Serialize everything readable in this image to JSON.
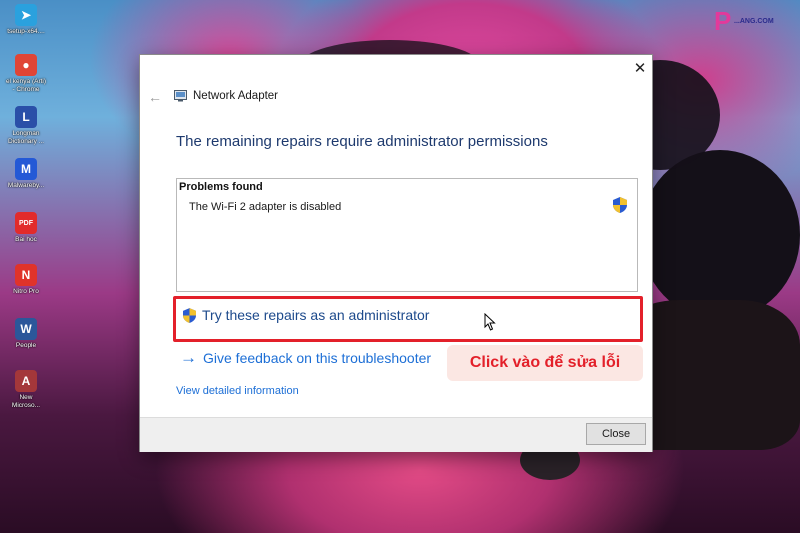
{
  "desktop": {
    "icons": [
      {
        "name": "telegram-icon",
        "label": "tsetup-x64....",
        "color": "#2aa1de",
        "glyph": "➤"
      },
      {
        "name": "chrome-icon",
        "label": "el kenya (Arti)\n- Chrome",
        "color": "#e04536",
        "glyph": "●"
      },
      {
        "name": "longman-dictionary-icon",
        "label": "Longman\nDictionary ...",
        "color": "#2a4fa8",
        "glyph": "L"
      },
      {
        "name": "malwarebytes-icon",
        "label": "Malwareby...",
        "color": "#2459d6",
        "glyph": "M"
      },
      {
        "name": "pdf-file-icon",
        "label": "Bai hoc",
        "color": "#e22b2b",
        "glyph": "PDF"
      },
      {
        "name": "nitro-pro-icon",
        "label": "Nitro Pro",
        "color": "#e0332a",
        "glyph": "N"
      },
      {
        "name": "word-doc-icon",
        "label": "People",
        "color": "#2b579a",
        "glyph": "W"
      },
      {
        "name": "access-file-icon",
        "label": "New\nMicroso...",
        "color": "#a4373a",
        "glyph": "A"
      }
    ]
  },
  "dialog": {
    "window_title": "Network Adapter",
    "heading": "The remaining repairs require administrator permissions",
    "problems_header": "Problems found",
    "problem_item": "The Wi-Fi 2 adapter is disabled",
    "repair_link": "Try these repairs as an administrator",
    "feedback_link": "Give feedback on this troubleshooter",
    "details_link": "View detailed information",
    "close_button": "Close",
    "close_glyph": "✕",
    "back_glyph": "←",
    "feedback_arrow_glyph": "→"
  },
  "annotation": {
    "callout_text": "Click vào để sửa lỗi",
    "highlight_color": "#e3202a"
  },
  "brand": {
    "logo_letter": "P",
    "logo_text": "...ANG.COM"
  }
}
